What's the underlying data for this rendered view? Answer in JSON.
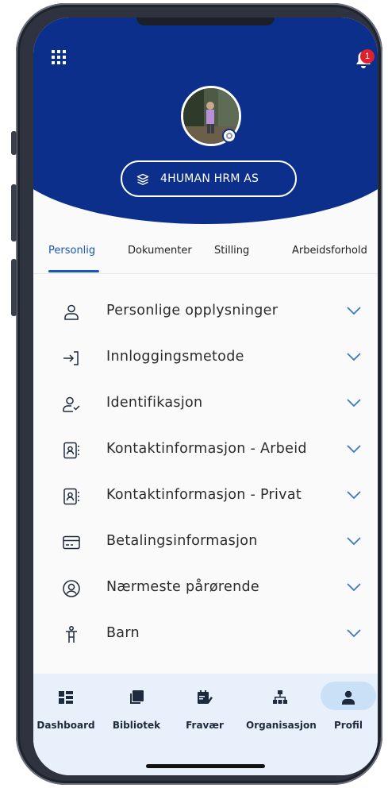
{
  "header": {
    "notification_count": "1",
    "company_name": "4HUMAN HRM AS"
  },
  "tabs": [
    {
      "label": "Personlig",
      "active": true
    },
    {
      "label": "Dokumenter",
      "active": false
    },
    {
      "label": "Stilling",
      "active": false
    },
    {
      "label": "Arbeidsforhold",
      "active": false
    }
  ],
  "sections": [
    {
      "label": "Personlige opplysninger",
      "icon": "person-icon"
    },
    {
      "label": "Innloggingsmetode",
      "icon": "login-icon"
    },
    {
      "label": "Identifikasjon",
      "icon": "person-check-icon"
    },
    {
      "label": "Kontaktinformasjon - Arbeid",
      "icon": "contact-card-icon"
    },
    {
      "label": "Kontaktinformasjon - Privat",
      "icon": "contact-card-icon"
    },
    {
      "label": "Betalingsinformasjon",
      "icon": "credit-card-icon"
    },
    {
      "label": "Nærmeste pårørende",
      "icon": "person-circle-icon"
    },
    {
      "label": "Barn",
      "icon": "child-icon"
    }
  ],
  "bottom_nav": [
    {
      "label": "Dashboard",
      "icon": "dashboard-icon",
      "active": false
    },
    {
      "label": "Bibliotek",
      "icon": "library-icon",
      "active": false
    },
    {
      "label": "Fravær",
      "icon": "absence-icon",
      "active": false
    },
    {
      "label": "Organisasjon",
      "icon": "org-chart-icon",
      "active": false
    },
    {
      "label": "Profil",
      "icon": "profile-icon",
      "active": true
    }
  ],
  "colors": {
    "header_blue": "#0b2f8a",
    "accent_blue": "#1a55b8",
    "chevron_blue": "#3a78c9",
    "bottom_bar": "#e8f1fb",
    "badge_red": "#e0202d"
  }
}
